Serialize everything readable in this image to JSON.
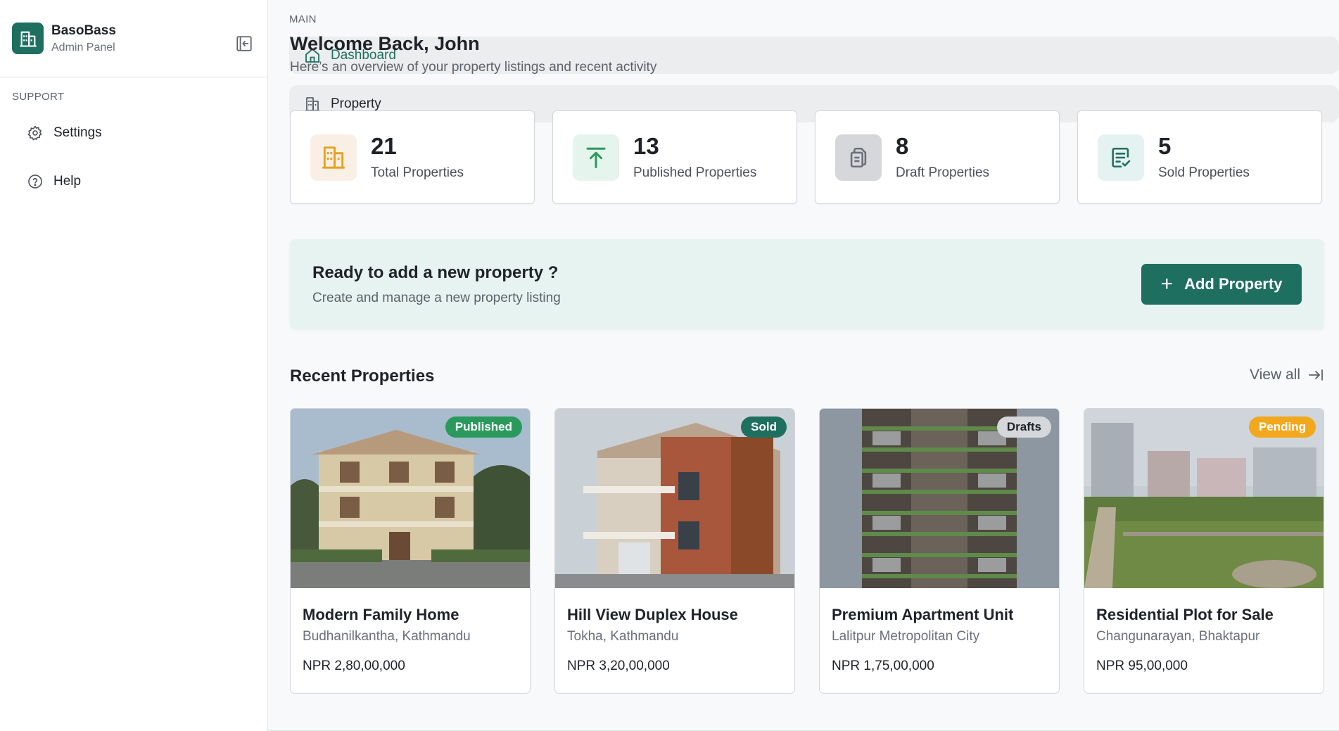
{
  "brand": {
    "name": "BasoBass",
    "subtitle": "Admin Panel"
  },
  "sidebar": {
    "main_heading": "MAIN",
    "main_items": [
      {
        "label": "Dashboard",
        "icon": "home-icon"
      },
      {
        "label": "Property",
        "icon": "building-icon"
      }
    ],
    "support_heading": "SUPPORT",
    "support_items": [
      {
        "label": "Settings",
        "icon": "gear-icon"
      },
      {
        "label": "Help",
        "icon": "help-icon"
      }
    ]
  },
  "header": {
    "title": "Welcome Back, John",
    "subtitle": "Here’s an overview of your property listings and recent activity"
  },
  "stats": [
    {
      "value": "21",
      "label": "Total Properties",
      "icon": "building-icon",
      "color": "#e8a020",
      "bg": "#f9efe4"
    },
    {
      "value": "13",
      "label": "Published Properties",
      "icon": "upload-icon",
      "color": "#2a9a5c",
      "bg": "#e5f4ec"
    },
    {
      "value": "8",
      "label": "Draft Properties",
      "icon": "copy-icon",
      "color": "#6a7079",
      "bg": "#d5d7da"
    },
    {
      "value": "5",
      "label": "Sold Properties",
      "icon": "document-check-icon",
      "color": "#1f6f60",
      "bg": "#e4f3f1"
    }
  ],
  "cta": {
    "title": "Ready to add a new property ?",
    "subtitle": "Create and manage a new property listing",
    "button_label": "Add Property"
  },
  "recent": {
    "title": "Recent Properties",
    "view_all": "View all",
    "properties": [
      {
        "title": "Modern Family Home",
        "location": "Budhanilkantha, Kathmandu",
        "price": "NPR 2,80,00,000",
        "status": "Published",
        "status_color": "#2a9a5c"
      },
      {
        "title": "Hill View Duplex House",
        "location": "Tokha, Kathmandu",
        "price": "NPR 3,20,00,000",
        "status": "Sold",
        "status_color": "#1f6f60"
      },
      {
        "title": "Premium Apartment Unit",
        "location": "Lalitpur Metropolitan City",
        "price": "NPR 1,75,00,000",
        "status": "Drafts",
        "status_color": "#d5d7da"
      },
      {
        "title": "Residential Plot for Sale",
        "location": "Changunarayan, Bhaktapur",
        "price": "NPR 95,00,000",
        "status": "Pending",
        "status_color": "#f2a81d"
      }
    ]
  },
  "colors": {
    "primary": "#1f6f60",
    "cta_bg": "#e6f3f1"
  }
}
